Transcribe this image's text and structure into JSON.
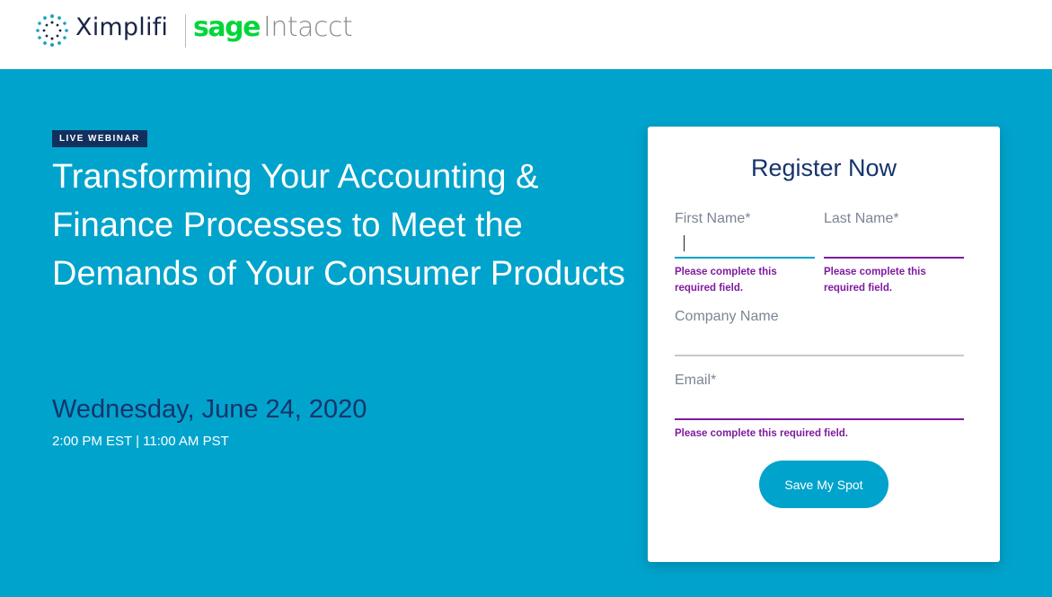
{
  "header": {
    "brand_primary": "Ximplifi",
    "brand_partner_1": "sage",
    "brand_partner_2": "Intacct"
  },
  "hero": {
    "badge": "LIVE WEBINAR",
    "title": "Transforming Your Accounting & Finance Processes to Meet the Demands of Your Consumer Products",
    "date": "Wednesday, June 24, 2020",
    "time": "2:00 PM EST | 11:00 AM PST"
  },
  "form": {
    "title": "Register Now",
    "first_name_label": "First Name*",
    "last_name_label": "Last Name*",
    "company_label": "Company Name",
    "email_label": "Email*",
    "first_name_error": "Please complete this required field.",
    "last_name_error": "Please complete this required field.",
    "email_error": "Please complete this required field.",
    "submit_label": "Save My Spot"
  },
  "colors": {
    "hero_background": "#00a3cc",
    "badge_background": "#12305e",
    "error": "#7f1b9e",
    "sage_green": "#00d639"
  }
}
